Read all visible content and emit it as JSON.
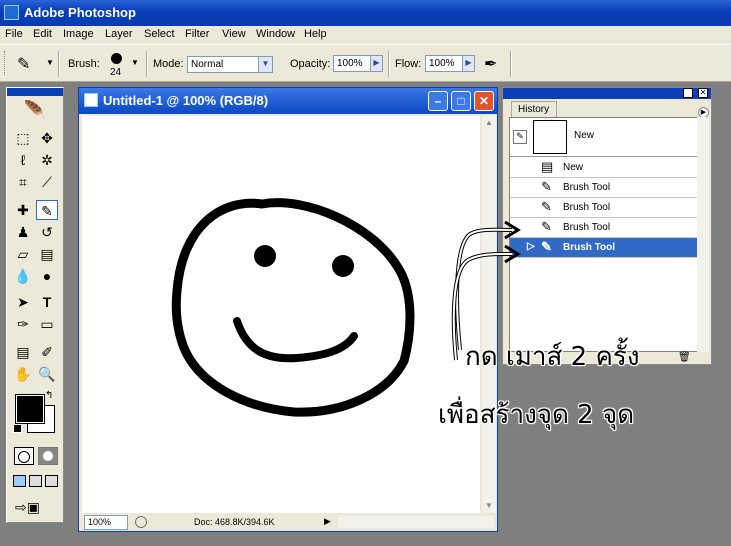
{
  "app": {
    "title": "Adobe Photoshop"
  },
  "menu": [
    "File",
    "Edit",
    "Image",
    "Layer",
    "Select",
    "Filter",
    "View",
    "Window",
    "Help"
  ],
  "options": {
    "brush_label": "Brush:",
    "brush_size": "24",
    "mode_label": "Mode:",
    "mode_value": "Normal",
    "opacity_label": "Opacity:",
    "opacity_value": "100%",
    "flow_label": "Flow:",
    "flow_value": "100%"
  },
  "document": {
    "title": "Untitled-1 @ 100% (RGB/8)",
    "zoom": "100%",
    "doc_info": "Doc: 468.8K/394.6K"
  },
  "history": {
    "tab": "History",
    "snapshot_label": "New",
    "items": [
      "New",
      "Brush Tool",
      "Brush Tool",
      "Brush Tool",
      "Brush Tool"
    ],
    "selected_index": 4
  },
  "annotation": {
    "line1": "กด เมาส์ 2 ครั้ง",
    "line2": "เพื่อสร้างจุด 2 จุด"
  },
  "colors": {
    "foreground": "#000000",
    "background": "#ffffff",
    "title_blue": "#0a3fb8",
    "selection": "#316ac5"
  }
}
